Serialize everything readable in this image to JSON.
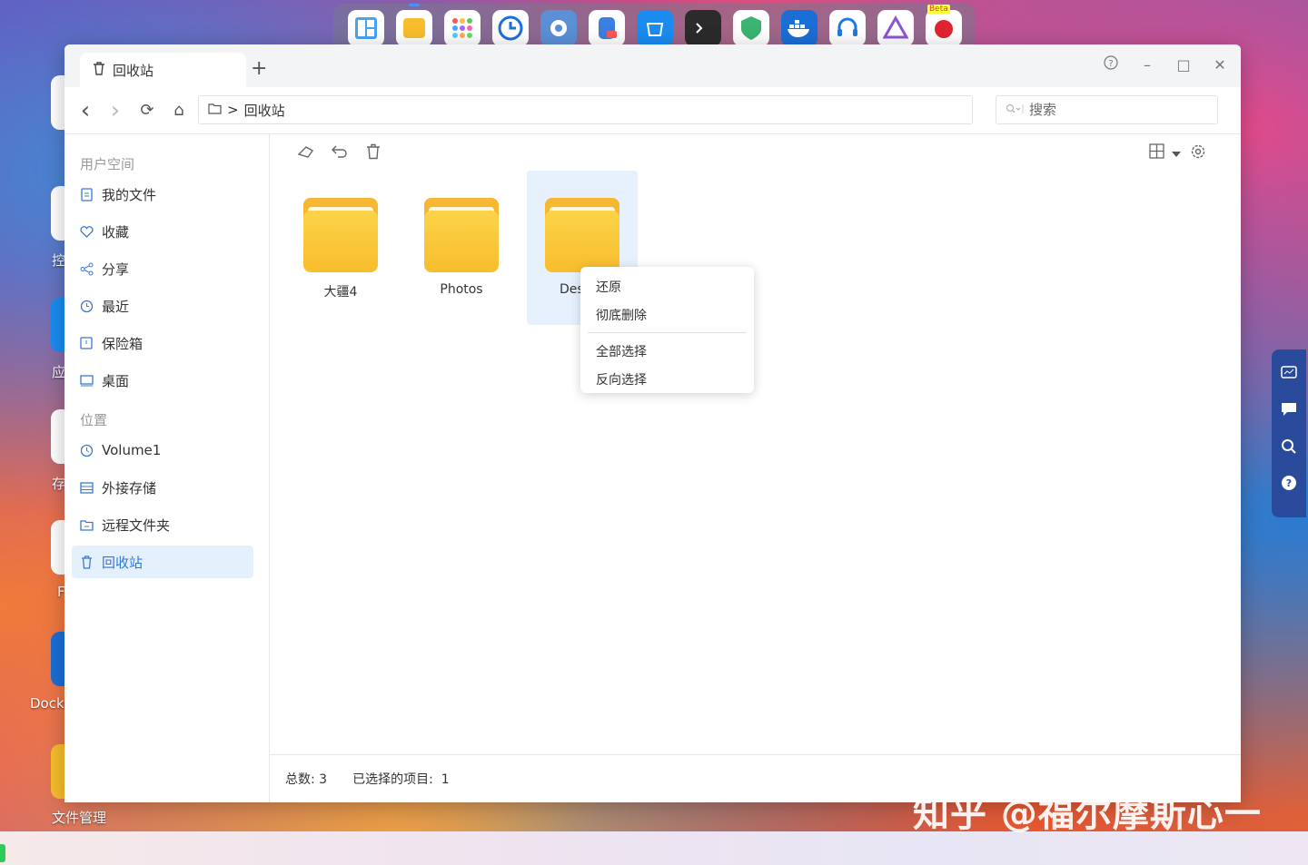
{
  "window": {
    "tab_title": "回收站",
    "add_tab": "+",
    "help": "?",
    "minimize": "–",
    "maximize": "□",
    "close": "✕"
  },
  "navbar": {
    "back": "‹",
    "forward": "›",
    "refresh": "⟳",
    "home": "⌂",
    "path_folder_icon": "folder-icon",
    "path_separator": ">",
    "path_current": "回收站",
    "search_placeholder": "搜索"
  },
  "sidebar": {
    "section_user": "用户空间",
    "section_location": "位置",
    "items": [
      {
        "label": "我的文件",
        "icon": "document-icon"
      },
      {
        "label": "收藏",
        "icon": "heart-icon"
      },
      {
        "label": "分享",
        "icon": "share-icon"
      },
      {
        "label": "最近",
        "icon": "clock-icon"
      },
      {
        "label": "保险箱",
        "icon": "safe-icon"
      },
      {
        "label": "桌面",
        "icon": "monitor-icon"
      },
      {
        "label": "Volume1",
        "icon": "disk-icon"
      },
      {
        "label": "外接存储",
        "icon": "external-storage-icon"
      },
      {
        "label": "远程文件夹",
        "icon": "remote-folder-icon"
      },
      {
        "label": "回收站",
        "icon": "trash-icon",
        "selected": true
      }
    ]
  },
  "files": [
    {
      "name": "大疆4",
      "selected": false
    },
    {
      "name": "Photos",
      "selected": false
    },
    {
      "name": "Des",
      "selected": true
    }
  ],
  "context_menu": {
    "items": [
      "还原",
      "彻底删除",
      "全部选择",
      "反向选择"
    ]
  },
  "status": {
    "total_label": "总数: 3",
    "selected_label": "已选择的项目:",
    "selected_count": "1"
  },
  "desktop": {
    "labels": [
      "控",
      "应",
      "存",
      "F",
      "Docke",
      "文件管理"
    ]
  },
  "dock": {
    "beta": "Beta"
  },
  "watermark": "知乎 @福尔摩斯心一",
  "colors": {
    "accent": "#2f78db",
    "folder": "#f6b832",
    "selection": "#e5f0fd",
    "side_panel": "#2a4b9c"
  }
}
